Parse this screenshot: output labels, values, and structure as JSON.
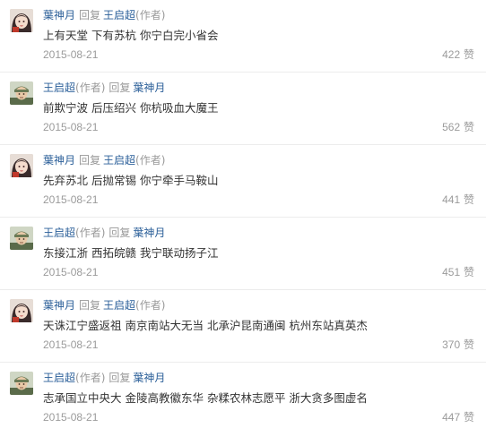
{
  "replies": [
    {
      "author": "葉神月",
      "author_tag": "",
      "action": "回复",
      "target": "王启超",
      "target_tag": "(作者)",
      "avatar_icon": "girl-avatar-icon",
      "content": "上有天堂 下有苏杭 你宁白完小省会",
      "date": "2015-08-21",
      "likes": "422",
      "like_label": "赞"
    },
    {
      "author": "王启超",
      "author_tag": "(作者)",
      "action": "回复",
      "target": "葉神月",
      "target_tag": "",
      "avatar_icon": "soldier-avatar-icon",
      "content": "前欺宁波 后压绍兴 你杭吸血大魔王",
      "date": "2015-08-21",
      "likes": "562",
      "like_label": "赞"
    },
    {
      "author": "葉神月",
      "author_tag": "",
      "action": "回复",
      "target": "王启超",
      "target_tag": "(作者)",
      "avatar_icon": "girl-avatar-icon",
      "content": "先弃苏北 后抛常锡 你宁牵手马鞍山",
      "date": "2015-08-21",
      "likes": "441",
      "like_label": "赞"
    },
    {
      "author": "王启超",
      "author_tag": "(作者)",
      "action": "回复",
      "target": "葉神月",
      "target_tag": "",
      "avatar_icon": "soldier-avatar-icon",
      "content": "东接江浙 西拓皖赣 我宁联动扬子江",
      "date": "2015-08-21",
      "likes": "451",
      "like_label": "赞"
    },
    {
      "author": "葉神月",
      "author_tag": "",
      "action": "回复",
      "target": "王启超",
      "target_tag": "(作者)",
      "avatar_icon": "girl-avatar-icon",
      "content": "天诛江宁盛返祖 南京南站大无当 北承沪昆南通闽 杭州东站真英杰",
      "date": "2015-08-21",
      "likes": "370",
      "like_label": "赞"
    },
    {
      "author": "王启超",
      "author_tag": "(作者)",
      "action": "回复",
      "target": "葉神月",
      "target_tag": "",
      "avatar_icon": "soldier-avatar-icon",
      "content": "志承国立中央大 金陵高教徽东华 杂糅农林志愿平 浙大贪多图虚名",
      "date": "2015-08-21",
      "likes": "447",
      "like_label": "赞"
    }
  ]
}
